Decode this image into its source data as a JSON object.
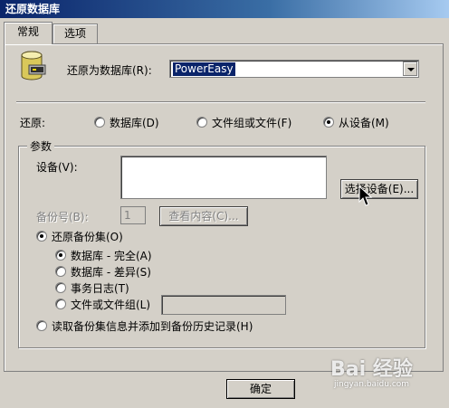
{
  "window": {
    "title": "还原数据库"
  },
  "tabs": [
    {
      "label": "常规",
      "active": true
    },
    {
      "label": "选项",
      "active": false
    }
  ],
  "restore_as": {
    "label": "还原为数据库(R):",
    "value": "PowerEasy"
  },
  "restore_from": {
    "label": "还原:",
    "options": [
      {
        "label": "数据库(D)",
        "checked": false
      },
      {
        "label": "文件组或文件(F)",
        "checked": false
      },
      {
        "label": "从设备(M)",
        "checked": true
      }
    ]
  },
  "params": {
    "title": "参数",
    "device_label": "设备(V):",
    "device_value": "",
    "select_device_button": "选择设备(E)...",
    "backup_no_label": "备份号(B):",
    "backup_no_value": "1",
    "view_contents_button": "查看内容(C)..."
  },
  "restore_set": {
    "label": "还原备份集(O)",
    "checked": true,
    "options": [
      {
        "label": "数据库 - 完全(A)",
        "checked": true
      },
      {
        "label": "数据库 - 差异(S)",
        "checked": false
      },
      {
        "label": "事务日志(T)",
        "checked": false
      },
      {
        "label": "文件或文件组(L)",
        "checked": false
      }
    ]
  },
  "read_backup_info": {
    "label": "读取备份集信息并添加到备份历史记录(H)",
    "checked": false
  },
  "footer": {
    "ok_button": "确定"
  },
  "watermark": {
    "main": "Bai 经验",
    "sub": "jingyan.baidu.com"
  }
}
